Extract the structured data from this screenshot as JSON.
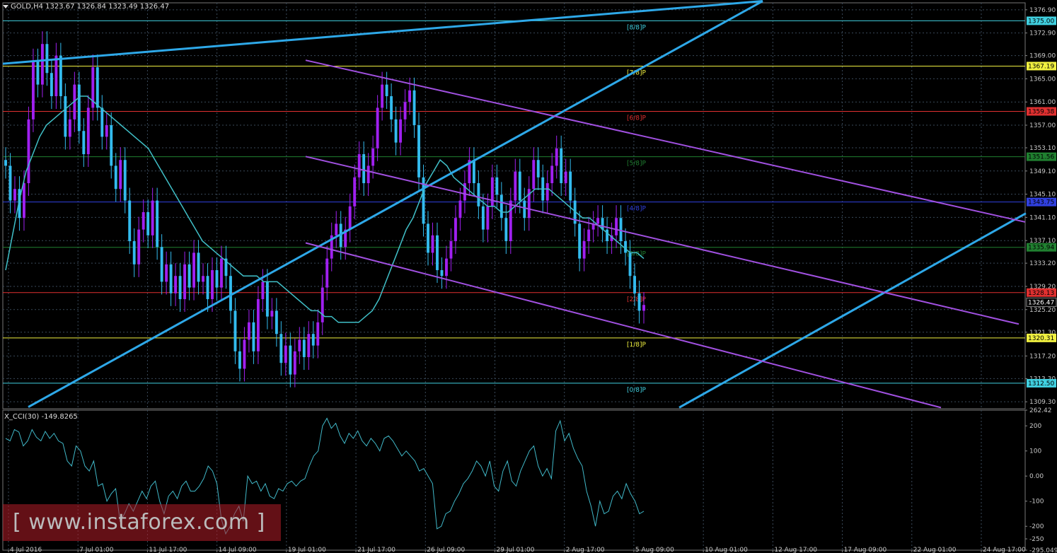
{
  "header": {
    "symbol_line": "GOLD,H4  1323.67 1326.84 1323.49 1326.47",
    "indicator_line": "X_CCI(30) -149.8265"
  },
  "watermark": {
    "text": "[ www.instaforex.com ]"
  },
  "colors": {
    "background": "#000000",
    "bull": "#a020f0",
    "bear": "#33bbee",
    "ma": "#40c0c8",
    "channel": "#a050e0",
    "trend": "#2ea8e8",
    "cci": "#40b8c8"
  },
  "chart_data": [
    {
      "type": "candlestick",
      "title": "GOLD,H4",
      "ohlc_readout": {
        "open": 1323.67,
        "high": 1326.84,
        "low": 1323.49,
        "close": 1326.47
      },
      "ylim": [
        1308.1,
        1378.1
      ],
      "y_ticks": [
        "1376.90",
        "1372.90",
        "1369.00",
        "1365.00",
        "1361.00",
        "1357.00",
        "1353.10",
        "1349.10",
        "1345.10",
        "1341.10",
        "1337.10",
        "1333.20",
        "1329.20",
        "1325.20",
        "1321.30",
        "1317.20",
        "1313.30",
        "1309.30"
      ],
      "x_ticks": [
        "4 Jul 2016",
        "7 Jul 01:00",
        "11 Jul 17:00",
        "14 Jul 09:00",
        "19 Jul 01:00",
        "21 Jul 17:00",
        "26 Jul 09:00",
        "29 Jul 01:00",
        "2 Aug 17:00",
        "5 Aug 09:00",
        "10 Aug 01:00",
        "12 Aug 17:00",
        "17 Aug 09:00",
        "22 Aug 01:00",
        "24 Aug 17:00"
      ],
      "murrey_levels": [
        {
          "label": "[8/8]P",
          "value": 1375.0,
          "tag": "1375.00",
          "color": "#40d0e0"
        },
        {
          "label": "[7/8]P",
          "value": 1367.19,
          "tag": "1367.19",
          "color": "#f0f040"
        },
        {
          "label": "[6/8]P",
          "value": 1359.38,
          "tag": "1359.38",
          "color": "#e03030"
        },
        {
          "label": "[5/8]P",
          "value": 1351.56,
          "tag": "1351.56",
          "color": "#208030"
        },
        {
          "label": "[4/8]P",
          "value": 1343.75,
          "tag": "1343.75",
          "color": "#3040e0"
        },
        {
          "label": "[3/8]P",
          "value": 1335.94,
          "tag": "1335.94",
          "color": "#208030"
        },
        {
          "label": "[2/8]P",
          "value": 1328.13,
          "tag": "1328.13",
          "color": "#e03030"
        },
        {
          "label": "[1/8]P",
          "value": 1320.31,
          "tag": "1320.31",
          "color": "#f0f040"
        },
        {
          "label": "[0/8]P",
          "value": 1312.5,
          "tag": "1312.50",
          "color": "#40d0e0"
        }
      ],
      "current_price": {
        "value": 1326.47,
        "tag": "1326.47"
      },
      "series": [
        {
          "name": "close",
          "values": [
            1350,
            1344,
            1346,
            1341,
            1347,
            1358,
            1368,
            1364,
            1371,
            1366,
            1362,
            1369,
            1362,
            1355,
            1358,
            1364,
            1356,
            1352,
            1360,
            1367,
            1360,
            1355,
            1357,
            1350,
            1346,
            1351,
            1344,
            1337,
            1333,
            1339,
            1342,
            1338,
            1344,
            1336,
            1330,
            1333,
            1328,
            1331,
            1327,
            1333,
            1329,
            1335,
            1330,
            1331,
            1327,
            1332,
            1329,
            1334,
            1331,
            1325,
            1318,
            1315,
            1320,
            1323,
            1318,
            1327,
            1330,
            1324,
            1325,
            1321,
            1316,
            1319,
            1314,
            1318,
            1320,
            1317,
            1321,
            1319,
            1323,
            1329,
            1334,
            1338,
            1340,
            1336,
            1339,
            1343,
            1348,
            1352,
            1347,
            1350,
            1353,
            1360,
            1364,
            1362,
            1358,
            1354,
            1358,
            1361,
            1363,
            1357,
            1348,
            1340,
            1335,
            1338,
            1332,
            1331,
            1334,
            1337,
            1341,
            1344,
            1347,
            1351,
            1347,
            1343,
            1339,
            1343,
            1348,
            1345,
            1341,
            1337,
            1344,
            1349,
            1344,
            1341,
            1346,
            1351,
            1348,
            1344,
            1347,
            1350,
            1353,
            1347,
            1349,
            1344,
            1340,
            1334,
            1337,
            1339,
            1340,
            1341,
            1339,
            1337,
            1338,
            1341,
            1337,
            1335,
            1331,
            1328,
            1325,
            1326
          ]
        },
        {
          "name": "ma",
          "values": [
            1332,
            1338,
            1344,
            1349,
            1352,
            1355,
            1357,
            1358,
            1359,
            1360,
            1361,
            1362,
            1362,
            1361,
            1360,
            1359,
            1358,
            1357,
            1356,
            1355,
            1354,
            1353,
            1351,
            1349,
            1347,
            1345,
            1343,
            1341,
            1339,
            1337,
            1336,
            1335,
            1334,
            1333,
            1332,
            1331,
            1331,
            1331,
            1330,
            1330,
            1330,
            1329,
            1328,
            1327,
            1326,
            1325,
            1325,
            1324,
            1324,
            1323,
            1323,
            1323,
            1323,
            1324,
            1325,
            1327,
            1330,
            1333,
            1336,
            1339,
            1341,
            1344,
            1347,
            1349,
            1351,
            1350,
            1348,
            1347,
            1346,
            1345,
            1344,
            1343,
            1343,
            1342,
            1342,
            1343,
            1344,
            1345,
            1346,
            1346,
            1346,
            1345,
            1344,
            1343,
            1342,
            1341,
            1341,
            1340,
            1339,
            1338,
            1337,
            1336,
            1335,
            1335,
            1334
          ]
        }
      ]
    },
    {
      "type": "line",
      "title": "X_CCI(30) -149.8265",
      "ylim": [
        -295.049,
        262.42
      ],
      "y_ticks": [
        "262.42",
        "200",
        "100",
        "0.00",
        "-100",
        "-200",
        "-250",
        "-295.049"
      ],
      "series": [
        {
          "name": "X_CCI(30)",
          "values": [
            150,
            140,
            185,
            175,
            120,
            140,
            185,
            155,
            140,
            178,
            150,
            170,
            140,
            130,
            60,
            40,
            120,
            100,
            40,
            20,
            60,
            -40,
            -30,
            -100,
            -70,
            -50,
            -180,
            -150,
            -110,
            -140,
            -100,
            -60,
            -90,
            -40,
            -20,
            -100,
            -150,
            -80,
            -60,
            -90,
            -40,
            -20,
            -60,
            -60,
            -40,
            -10,
            40,
            20,
            -30,
            -170,
            -230,
            -200,
            -150,
            -120,
            -180,
            0,
            -30,
            -20,
            -60,
            -30,
            -80,
            -90,
            -50,
            -60,
            -30,
            -20,
            -40,
            -20,
            -10,
            40,
            80,
            100,
            200,
            230,
            190,
            210,
            160,
            130,
            170,
            150,
            180,
            140,
            120,
            150,
            130,
            100,
            150,
            160,
            140,
            110,
            80,
            100,
            80,
            60,
            20,
            30,
            0,
            -30,
            -210,
            -200,
            -150,
            -140,
            -100,
            -70,
            -30,
            -10,
            20,
            60,
            40,
            0,
            60,
            -40,
            -60,
            20,
            60,
            -20,
            -40,
            20,
            60,
            100,
            120,
            40,
            0,
            30,
            -10,
            180,
            220,
            140,
            170,
            110,
            70,
            40,
            -60,
            -120,
            -200,
            -100,
            -150,
            -140,
            -80,
            -60,
            -90,
            -30,
            -70,
            -100,
            -150,
            -140
          ]
        }
      ]
    }
  ]
}
